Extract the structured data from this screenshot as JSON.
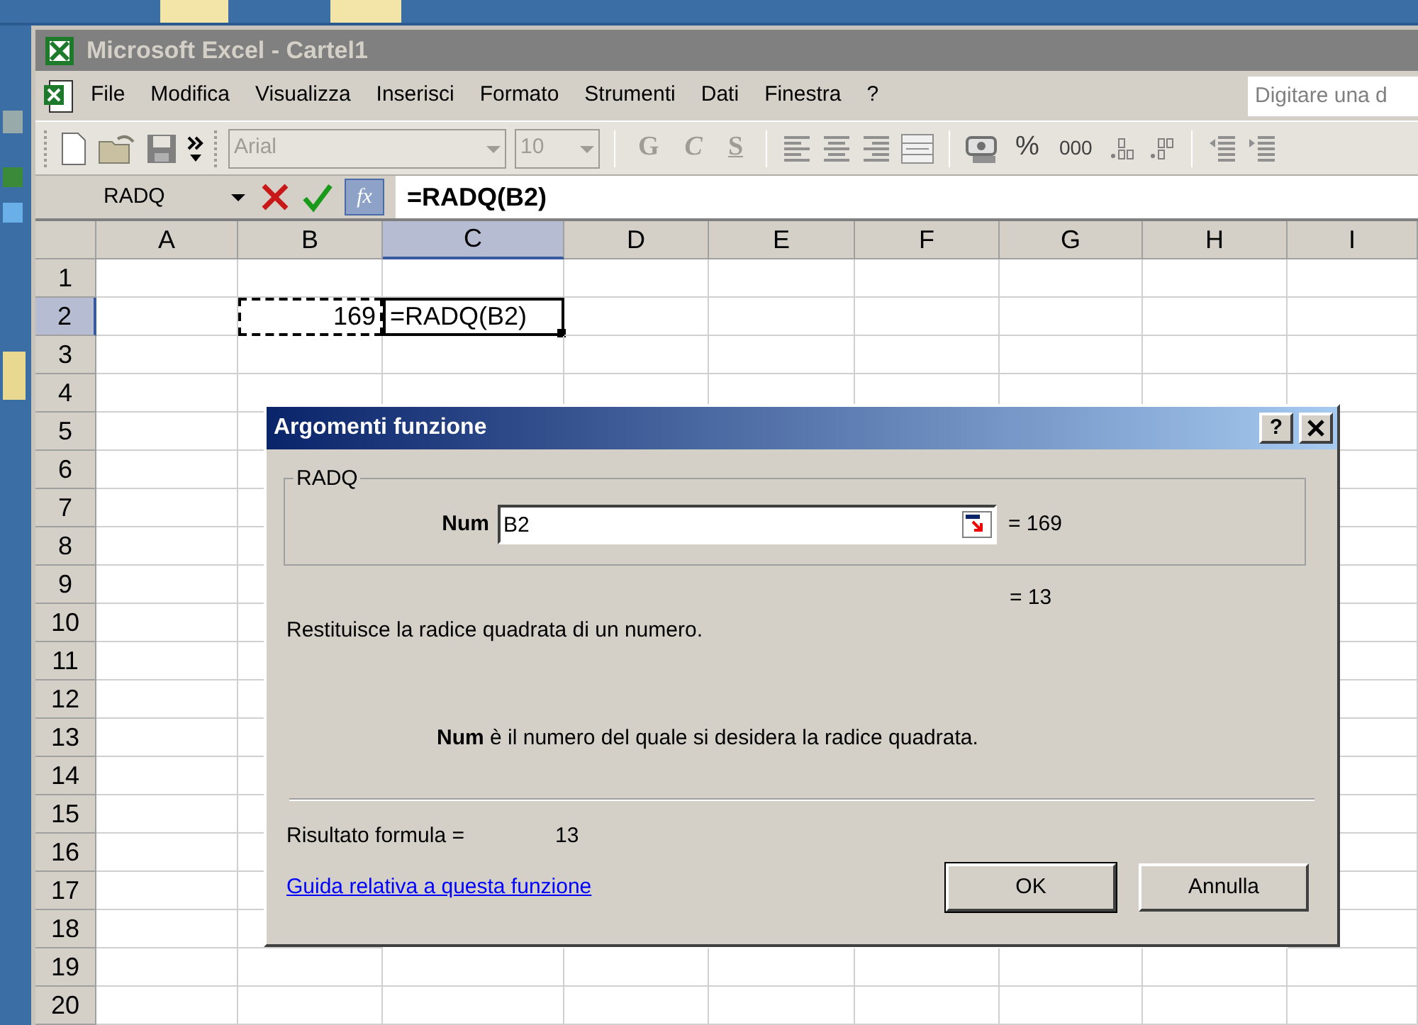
{
  "window": {
    "title": "Microsoft Excel - Cartel1",
    "active": false
  },
  "menu": {
    "items": [
      {
        "label": "File"
      },
      {
        "label": "Modifica"
      },
      {
        "label": "Visualizza"
      },
      {
        "label": "Inserisci"
      },
      {
        "label": "Formato"
      },
      {
        "label": "Strumenti"
      },
      {
        "label": "Dati"
      },
      {
        "label": "Finestra"
      },
      {
        "label": "?"
      }
    ],
    "help_box": {
      "placeholder": "Digitare una d"
    }
  },
  "toolbar": {
    "font": {
      "value": "Arial",
      "disabled": true
    },
    "size": {
      "value": "10",
      "disabled": true
    },
    "format_buttons": [
      {
        "label": "G",
        "kind": "bold",
        "disabled": true
      },
      {
        "label": "C",
        "kind": "italic",
        "disabled": true
      },
      {
        "label": "S",
        "kind": "underline",
        "disabled": true
      }
    ],
    "number_buttons": [
      {
        "label": "%",
        "disabled": false
      },
      {
        "label": "000",
        "disabled": false
      }
    ]
  },
  "formula_bar": {
    "name_box": "RADQ",
    "function_button": "fx",
    "formula": "=RADQ(B2)"
  },
  "sheet": {
    "columns": [
      {
        "label": "A",
        "selected": false
      },
      {
        "label": "B",
        "selected": false
      },
      {
        "label": "C",
        "selected": true
      },
      {
        "label": "D",
        "selected": false
      },
      {
        "label": "E",
        "selected": false
      },
      {
        "label": "F",
        "selected": false
      },
      {
        "label": "G",
        "selected": false
      },
      {
        "label": "H",
        "selected": false
      },
      {
        "label": "I",
        "selected": false
      }
    ],
    "rows": [
      {
        "label": "1",
        "selected": false
      },
      {
        "label": "2",
        "selected": true,
        "cells": [
          {
            "kind": "empty"
          },
          {
            "kind": "referenced",
            "value": "169"
          },
          {
            "kind": "active",
            "value": "=RADQ(B2)"
          }
        ]
      },
      {
        "label": "3",
        "selected": false
      },
      {
        "label": "4",
        "selected": false
      },
      {
        "label": "5",
        "selected": false
      },
      {
        "label": "6",
        "selected": false
      },
      {
        "label": "7",
        "selected": false
      },
      {
        "label": "8",
        "selected": false
      },
      {
        "label": "9",
        "selected": false
      },
      {
        "label": "10",
        "selected": false
      },
      {
        "label": "11",
        "selected": false
      },
      {
        "label": "12",
        "selected": false
      },
      {
        "label": "13",
        "selected": false
      },
      {
        "label": "14",
        "selected": false
      },
      {
        "label": "15",
        "selected": false
      },
      {
        "label": "16",
        "selected": false
      },
      {
        "label": "17",
        "selected": false
      },
      {
        "label": "18",
        "selected": false
      },
      {
        "label": "19",
        "selected": false
      },
      {
        "label": "20",
        "selected": false
      }
    ]
  },
  "dialog": {
    "title": "Argomenti funzione",
    "help_button": "?",
    "function_name": "RADQ",
    "arguments": [
      {
        "label": "Num",
        "value": "B2",
        "result": "= 169"
      }
    ],
    "result_preview": "= 13",
    "description": "Restituisce la radice quadrata di un numero.",
    "argument_help": "**Num** è il numero del quale si desidera la radice quadrata.",
    "formula_result_label": "Risultato formula =",
    "formula_result": "13",
    "help_link": "Guida relativa a questa funzione",
    "buttons": [
      {
        "label": "OK",
        "default": true
      },
      {
        "label": "Annulla",
        "default": false
      }
    ]
  }
}
